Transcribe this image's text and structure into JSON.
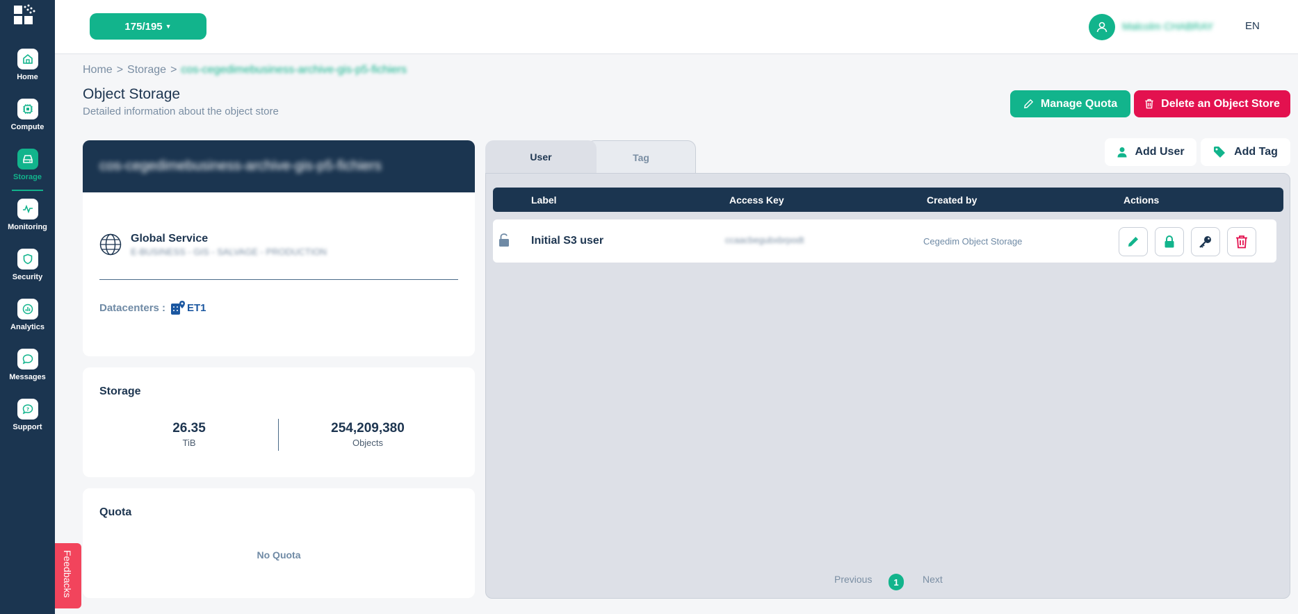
{
  "sidebar": {
    "items": [
      {
        "label": "Home",
        "icon": "home-icon"
      },
      {
        "label": "Compute",
        "icon": "chip-icon"
      },
      {
        "label": "Storage",
        "icon": "storage-icon",
        "active": true
      },
      {
        "label": "Monitoring",
        "icon": "pulse-icon"
      },
      {
        "label": "Security",
        "icon": "shield-icon"
      },
      {
        "label": "Analytics",
        "icon": "chart-icon"
      },
      {
        "label": "Messages",
        "icon": "chat-icon"
      },
      {
        "label": "Support",
        "icon": "support-icon"
      }
    ]
  },
  "header": {
    "project": "175/195",
    "username": "Malcolm CHABRAY",
    "language": "EN"
  },
  "breadcrumb": {
    "home": "Home",
    "storage": "Storage",
    "current": "cos-cegedimebusiness-archive-gis-p5-fichiers"
  },
  "page": {
    "title": "Object Storage",
    "subtitle": "Detailed information about the object store"
  },
  "actions": {
    "manage_quota": "Manage Quota",
    "delete_store": "Delete an Object Store"
  },
  "store": {
    "name": "cos-cegedimebusiness-archive-gis-p5-fichiers",
    "service_title": "Global Service",
    "service_detail": "E-BUSINESS - GIS - SALVAGE - PRODUCTION",
    "datacenters_label": "Datacenters :",
    "datacenter": "ET1"
  },
  "storage": {
    "title": "Storage",
    "size_value": "26.35",
    "size_unit": "TiB",
    "objects_value": "254,209,380",
    "objects_unit": "Objects"
  },
  "quota": {
    "title": "Quota",
    "empty": "No Quota"
  },
  "tabs": {
    "user": "User",
    "tag": "Tag"
  },
  "panel_actions": {
    "add_user": "Add User",
    "add_tag": "Add Tag"
  },
  "table": {
    "columns": [
      "Label",
      "Access Key",
      "Created by",
      "Actions"
    ],
    "rows": [
      {
        "label": "Initial S3 user",
        "access_key": "ccaacbegubxbrpodt",
        "created_by": "Cegedim Object Storage"
      }
    ]
  },
  "pagination": {
    "previous": "Previous",
    "current": "1",
    "next": "Next"
  },
  "feedback": "Feedbacks",
  "colors": {
    "primary": "#12b48c",
    "navy": "#1b3550",
    "danger": "#e3114f",
    "feedback": "#f2445c"
  }
}
